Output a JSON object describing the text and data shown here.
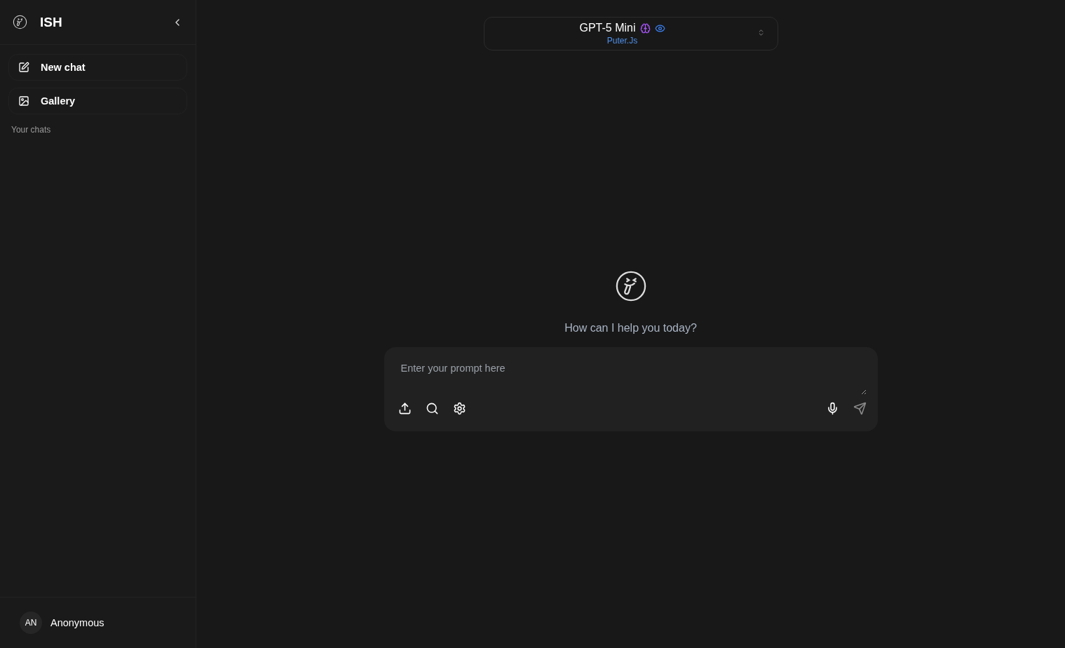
{
  "sidebar": {
    "app_name": "ISH",
    "items": [
      {
        "kind": "new",
        "label": "New chat"
      },
      {
        "kind": "gallery",
        "label": "Gallery"
      }
    ],
    "section_label": "Your chats",
    "user": {
      "initials": "AN",
      "name": "Anonymous"
    }
  },
  "model_selector": {
    "name": "GPT-5 Mini",
    "provider": "Puter.Js"
  },
  "greeting": "How can I help you today?",
  "prompt": {
    "placeholder": "Enter your prompt here",
    "send_disabled": true
  }
}
